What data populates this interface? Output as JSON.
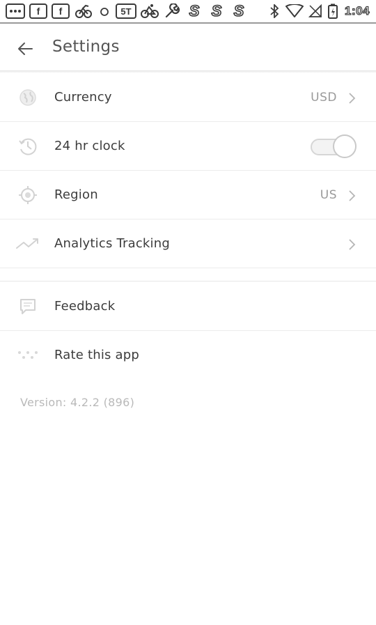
{
  "status_bar": {
    "notification_icons": [
      "chat-bubble-icon",
      "facebook-icon",
      "facebook-icon",
      "bike-icon",
      "circle-icon",
      "strava-icon",
      "cycle-icon",
      "wrench-icon",
      "s-app-icon",
      "s-app-icon",
      "s-app-icon"
    ],
    "facebook_letter": "f",
    "badge_text": "5T",
    "s_letter": "S",
    "time": "1:04"
  },
  "app_bar": {
    "title": "Settings"
  },
  "settings": {
    "currency": {
      "label": "Currency",
      "value": "USD"
    },
    "clock": {
      "label": "24 hr clock",
      "enabled": false
    },
    "region": {
      "label": "Region",
      "value": "US"
    },
    "analytics": {
      "label": "Analytics Tracking"
    }
  },
  "support": {
    "feedback": {
      "label": "Feedback"
    },
    "rate": {
      "label": "Rate this app"
    }
  },
  "version": "Version: 4.2.2 (896)"
}
